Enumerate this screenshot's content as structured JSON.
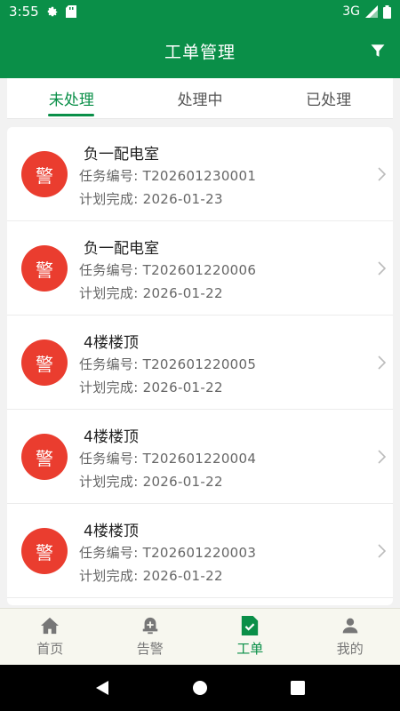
{
  "status_bar": {
    "time": "3:55",
    "network": "3G",
    "left_icons": [
      "gear-icon",
      "sd-card-icon"
    ],
    "right_icons": [
      "signal-icon",
      "battery-icon"
    ]
  },
  "app_bar": {
    "title": "工单管理",
    "filter_icon": "filter-icon"
  },
  "tabs": [
    {
      "label": "未处理",
      "active": true
    },
    {
      "label": "处理中",
      "active": false
    },
    {
      "label": "已处理",
      "active": false
    }
  ],
  "orders": [
    {
      "badge": "警",
      "location": "负一配电室",
      "task_no": "任务编号: T202601230001",
      "plan_done": "计划完成: 2026-01-23"
    },
    {
      "badge": "警",
      "location": "负一配电室",
      "task_no": "任务编号: T202601220006",
      "plan_done": "计划完成: 2026-01-22"
    },
    {
      "badge": "警",
      "location": "4楼楼顶",
      "task_no": "任务编号: T202601220005",
      "plan_done": "计划完成: 2026-01-22"
    },
    {
      "badge": "警",
      "location": "4楼楼顶",
      "task_no": "任务编号: T202601220004",
      "plan_done": "计划完成: 2026-01-22"
    },
    {
      "badge": "警",
      "location": "4楼楼顶",
      "task_no": "任务编号: T202601220003",
      "plan_done": "计划完成: 2026-01-22"
    }
  ],
  "bottom_nav": [
    {
      "label": "首页",
      "icon": "home-icon",
      "active": false
    },
    {
      "label": "告警",
      "icon": "alarm-bell-icon",
      "active": false
    },
    {
      "label": "工单",
      "icon": "work-order-icon",
      "active": true
    },
    {
      "label": "我的",
      "icon": "user-icon",
      "active": false
    }
  ],
  "colors": {
    "primary": "#0a8f48",
    "alarm": "#ea3d2f",
    "nav_bg": "#f7f7ef"
  }
}
